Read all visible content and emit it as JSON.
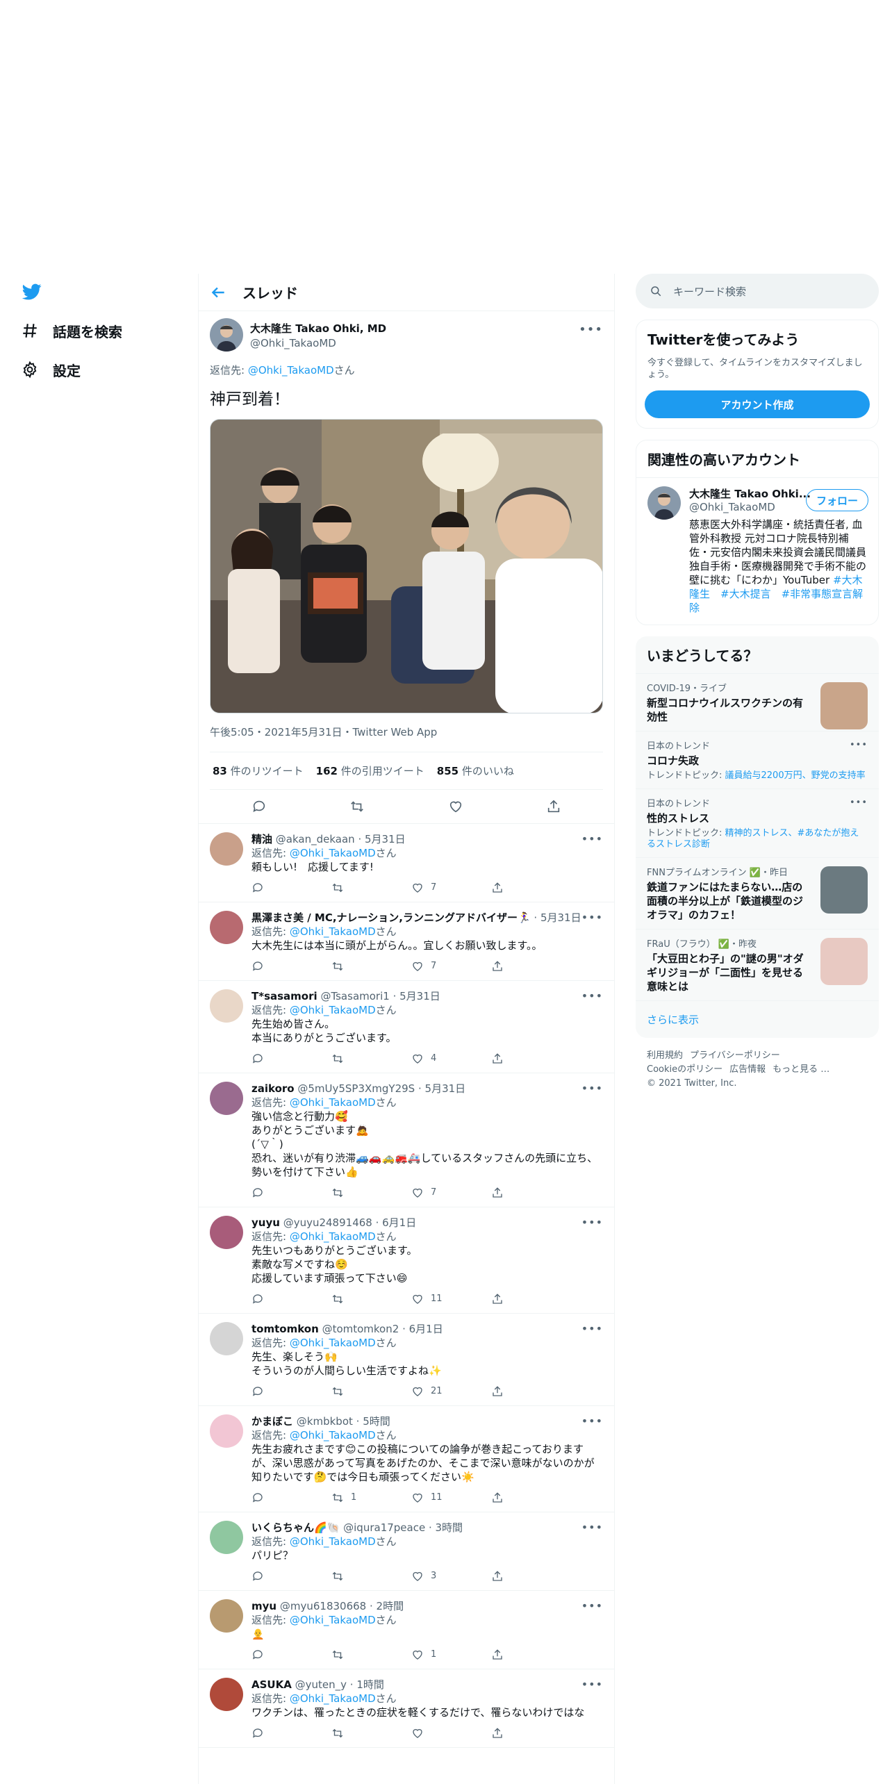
{
  "nav": {
    "explore": "話題を検索",
    "settings": "設定"
  },
  "header": {
    "title": "スレッド"
  },
  "main_tweet": {
    "name": "大木隆生 Takao Ohki, MD",
    "handle": "@Ohki_TakaoMD",
    "reply_prefix": "返信先: ",
    "reply_to": "@Ohki_TakaoMD",
    "reply_suffix": "さん",
    "text": "神戸到着！",
    "meta": "午後5:05・2021年5月31日・Twitter Web App",
    "retweets": "83",
    "retweets_label": "件のリツイート",
    "quotes": "162",
    "quotes_label": "件の引用ツイート",
    "likes": "855",
    "likes_label": "件のいいね"
  },
  "replies": [
    {
      "name": "精油",
      "handle": "@akan_dekaan",
      "time": "5月31日",
      "reply_to": "@Ohki_TakaoMD",
      "text": "頼もしい!　応援してます!",
      "retweets": "",
      "likes": "7",
      "avatar_color": "#c9a08a"
    },
    {
      "name": "黒澤まさ美 / MC,ナレーション,ランニングアドバイザー🏃‍♀️",
      "handle": "",
      "time": "5月31日",
      "reply_to": "@Ohki_TakaoMD",
      "text": "大木先生には本当に頭が上がらん。。宜しくお願い致します。。",
      "retweets": "",
      "likes": "7",
      "avatar_color": "#b86a70"
    },
    {
      "name": "T*sasamori",
      "handle": "@Tsasamori1",
      "time": "5月31日",
      "reply_to": "@Ohki_TakaoMD",
      "text": "先生始め皆さん。\n本当にありがとうございます。",
      "retweets": "",
      "likes": "4",
      "avatar_color": "#e9d7c8"
    },
    {
      "name": "zaikoro",
      "handle": "@5mUy5SP3XmgY29S",
      "time": "5月31日",
      "reply_to": "@Ohki_TakaoMD",
      "text": "強い信念と行動力🥰\nありがとうございます🙇\n(´▽｀)\n恐れ、迷いが有り渋滞🚙🚗🚕🚒🚑しているスタッフさんの先頭に立ち、\n勢いを付けて下さい👍",
      "retweets": "",
      "likes": "7",
      "avatar_color": "#9a6b8f"
    },
    {
      "name": "yuyu",
      "handle": "@yuyu24891468",
      "time": "6月1日",
      "reply_to": "@Ohki_TakaoMD",
      "text": "先生いつもありがとうございます。\n素敵な写メですね☺️\n応援しています頑張って下さい😄",
      "retweets": "",
      "likes": "11",
      "avatar_color": "#a85c7a"
    },
    {
      "name": "tomtomkon",
      "handle": "@tomtomkon2",
      "time": "6月1日",
      "reply_to": "@Ohki_TakaoMD",
      "text": "先生、楽しそう🙌\nそういうのが人間らしい生活ですよね✨",
      "retweets": "",
      "likes": "21",
      "avatar_color": "#d5d5d5"
    },
    {
      "name": "かまぼこ",
      "handle": "@kmbkbot",
      "time": "5時間",
      "reply_to": "@Ohki_TakaoMD",
      "text": "先生お疲れさまです😊この投稿についての論争が巻き起こっておりますが、深い思惑があって写真をあげたのか、そこまで深い意味がないのかが知りたいです🤔では今日も頑張ってください☀️",
      "retweets": "1",
      "likes": "11",
      "avatar_color": "#f2c6d4"
    },
    {
      "name": "いくらちゃん🌈🐚",
      "handle": "@iqura17peace",
      "time": "3時間",
      "reply_to": "@Ohki_TakaoMD",
      "text": "パリピ？",
      "retweets": "",
      "likes": "3",
      "avatar_color": "#8fc7a0"
    },
    {
      "name": "myu",
      "handle": "@myu61830668",
      "time": "2時間",
      "reply_to": "@Ohki_TakaoMD",
      "text": "🧑‍🦲",
      "retweets": "",
      "likes": "1",
      "avatar_color": "#b89a70"
    },
    {
      "name": "ASUKA",
      "handle": "@yuten_y",
      "time": "1時間",
      "reply_to": "@Ohki_TakaoMD",
      "text": "ワクチンは、罹ったときの症状を軽くするだけで、罹らないわけではな",
      "retweets": "",
      "likes": "",
      "avatar_color": "#b04a3a"
    }
  ],
  "reply_prefix": "返信先: ",
  "reply_suffix": "さん",
  "right": {
    "search_placeholder": "キーワード検索",
    "signup": {
      "title": "Twitterを使ってみよう",
      "text": "今すぐ登録して、タイムラインをカスタマイズしましょう。",
      "button": "アカウント作成"
    },
    "relevant": {
      "title": "関連性の高いアカウント",
      "name": "大木隆生 Takao Ohki...",
      "handle": "@Ohki_TakaoMD",
      "follow": "フォロー",
      "bio": "慈恵医大外科学講座・統括責任者, 血管外科教授 元対コロナ院長特別補佐・元安倍内閣未来投資会議民間議員 独自手術・医療機器開発で手術不能の壁に挑む「にわか」YouTuber ",
      "tags": "#大木隆生　#大木提言　#非常事態宣言解除"
    },
    "trends": {
      "title": "いまどうしてる？",
      "items": [
        {
          "cat": "COVID-19・ライブ",
          "title": "新型コロナウイルスワクチンの有効性",
          "sub": "",
          "sub_link": "",
          "image": true,
          "img_color": "#c9a58a"
        },
        {
          "cat": "日本のトレンド",
          "title": "コロナ失政",
          "sub": "トレンドトピック: ",
          "sub_link": "議員給与2200万円、野党の支持率",
          "image": false
        },
        {
          "cat": "日本のトレンド",
          "title": "性的ストレス",
          "sub": "トレンドトピック: ",
          "sub_link": "精神的ストレス、#あなたが抱えるストレス診断",
          "image": false
        },
        {
          "cat": "FNNプライムオンライン ✅・昨日",
          "title": "鉄道ファンにはたまらない…店の面積の半分以上が「鉄道模型のジオラマ」のカフェ！",
          "sub": "",
          "sub_link": "",
          "image": true,
          "img_color": "#6b7a80"
        },
        {
          "cat": "FRaU（フラウ） ✅・昨夜",
          "title": "「大豆田とわ子」の\"謎の男\"オダギリジョーが「二面性」を見せる意味とは",
          "sub": "",
          "sub_link": "",
          "image": true,
          "img_color": "#e8c9c2"
        }
      ],
      "show_more": "さらに表示"
    },
    "footer": {
      "l1": [
        "利用規約",
        "プライバシーポリシー"
      ],
      "l2": [
        "Cookieのポリシー",
        "広告情報",
        "もっと見る …"
      ],
      "copyright": "© 2021 Twitter, Inc."
    }
  }
}
